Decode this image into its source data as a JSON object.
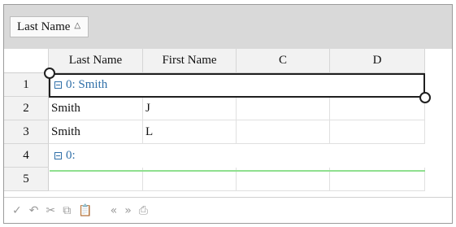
{
  "group_panel": {
    "chip_label": "Last Name",
    "sort_icon": "triangle-up-icon"
  },
  "columns": [
    "Last Name",
    "First Name",
    "C",
    "D"
  ],
  "rows": [
    {
      "num": "1",
      "type": "group",
      "label": "0: Smith"
    },
    {
      "num": "2",
      "type": "data",
      "cells": [
        "Smith",
        "J",
        "",
        ""
      ]
    },
    {
      "num": "3",
      "type": "data",
      "cells": [
        "Smith",
        "L",
        "",
        ""
      ]
    },
    {
      "num": "4",
      "type": "group",
      "label": "0:"
    },
    {
      "num": "5",
      "type": "data",
      "cells": [
        "",
        "",
        "",
        ""
      ]
    }
  ],
  "toolbar": {
    "icons": [
      "check-icon",
      "undo-icon",
      "cut-icon",
      "copy-icon",
      "paste-icon",
      "prev-icon",
      "next-icon",
      "print-icon"
    ],
    "glyphs": {
      "check": "✓",
      "undo": "↶",
      "cut": "✂",
      "copy": "⧉",
      "paste": "📋",
      "prev": "«",
      "next": "»",
      "print": "⎙"
    }
  },
  "colors": {
    "group_text": "#2f6fa8",
    "panel_bg": "#d9d9d9",
    "new_row_line": "#8fe08f"
  }
}
